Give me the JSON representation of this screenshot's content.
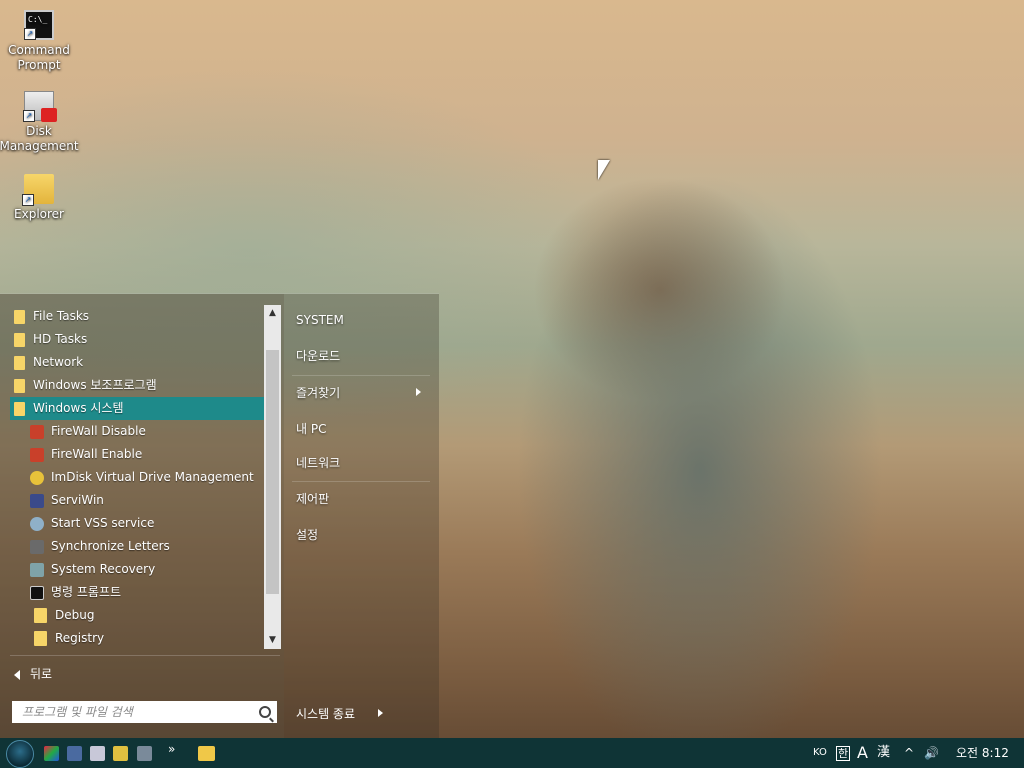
{
  "desktop": {
    "icons": [
      {
        "label_line1": "Command",
        "label_line2": "Prompt",
        "icon": "command-prompt-icon"
      },
      {
        "label_line1": "Disk",
        "label_line2": "Management",
        "icon": "disk-management-icon"
      },
      {
        "label_line1": "Explorer",
        "label_line2": "",
        "icon": "explorer-folder-icon"
      }
    ]
  },
  "start_menu": {
    "items": [
      {
        "label": "File Tasks",
        "icon": "folder-icon"
      },
      {
        "label": "HD Tasks",
        "icon": "folder-icon"
      },
      {
        "label": "Network",
        "icon": "folder-icon"
      },
      {
        "label": "Windows 보조프로그램",
        "icon": "folder-icon"
      },
      {
        "label": "Windows 시스템",
        "icon": "folder-icon",
        "selected": true
      },
      {
        "label": "FireWall Disable",
        "icon": "firewall-icon"
      },
      {
        "label": "FireWall Enable",
        "icon": "firewall-icon"
      },
      {
        "label": "ImDisk Virtual Drive Management",
        "icon": "disk-icon"
      },
      {
        "label": "ServiWin",
        "icon": "services-icon"
      },
      {
        "label": "Start VSS service",
        "icon": "gear-icon"
      },
      {
        "label": "Synchronize Letters",
        "icon": "sync-icon"
      },
      {
        "label": "System Recovery",
        "icon": "recovery-icon"
      },
      {
        "label": "명령 프롬프트",
        "icon": "command-prompt-icon"
      },
      {
        "label": "Debug",
        "icon": "folder-icon"
      },
      {
        "label": "Registry",
        "icon": "folder-icon"
      }
    ],
    "back_label": "뒤로",
    "search_placeholder": "프로그램 및 파일 검색",
    "right": {
      "system": "SYSTEM",
      "downloads": "다운로드",
      "favorites": "즐겨찾기",
      "this_pc": "내 PC",
      "network": "네트워크",
      "control_panel": "제어판",
      "settings": "설정",
      "shutdown": "시스템 종료"
    }
  },
  "taskbar": {
    "more": "»",
    "tray": {
      "lang": "KO",
      "ime_han": "한",
      "ime_a": "A",
      "ime_hanja": "漢",
      "up_arrow": "^",
      "volume": "🔊",
      "time": "오전 8:12"
    }
  },
  "colors": {
    "selected": "#1e8a8a",
    "folder": "#f7d568",
    "taskbar": "#0f3436"
  }
}
